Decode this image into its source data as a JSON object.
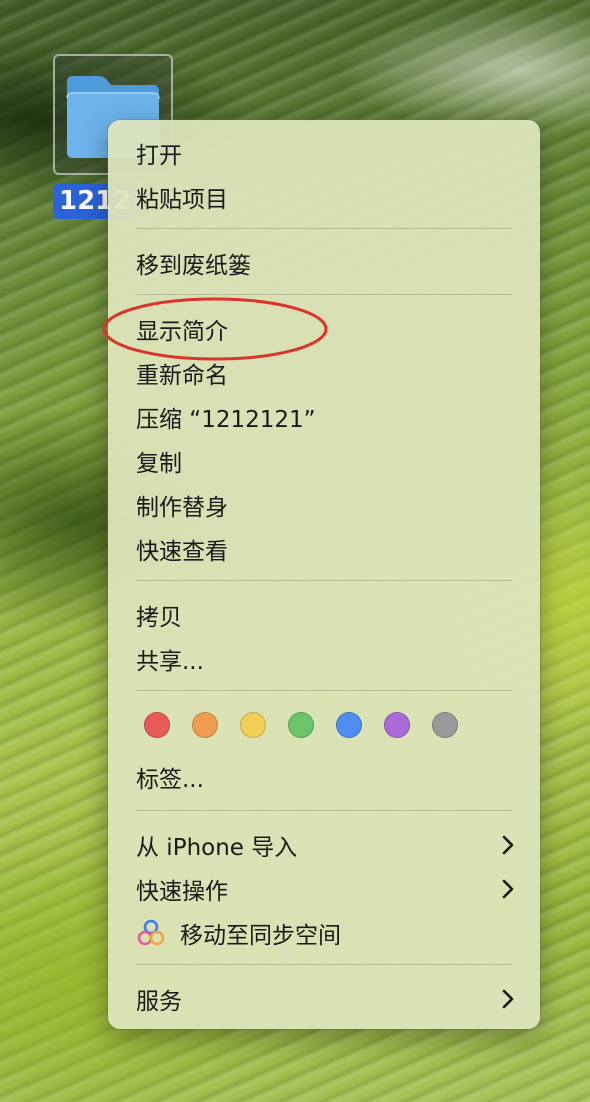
{
  "desktop": {
    "folder": {
      "label": "1212"
    }
  },
  "context_menu": {
    "open": "打开",
    "paste_item": "粘贴项目",
    "move_to_trash": "移到废纸篓",
    "get_info": "显示简介",
    "rename": "重新命名",
    "compress": "压缩 “1212121”",
    "duplicate": "复制",
    "make_alias": "制作替身",
    "quick_look": "快速查看",
    "copy": "拷贝",
    "share": "共享...",
    "tags_label": "标签...",
    "tag_colors": [
      "#e85a55",
      "#ee9c50",
      "#f2cf58",
      "#6cc46a",
      "#4d8ef0",
      "#a86ad6",
      "#9a9a9a"
    ],
    "import_from_iphone": "从 iPhone 导入",
    "quick_actions": "快速操作",
    "move_to_sync_space": "移动至同步空间",
    "services": "服务"
  },
  "colors": {
    "selection_blue": "#2b63d9",
    "annotation_red": "#d9352b"
  }
}
